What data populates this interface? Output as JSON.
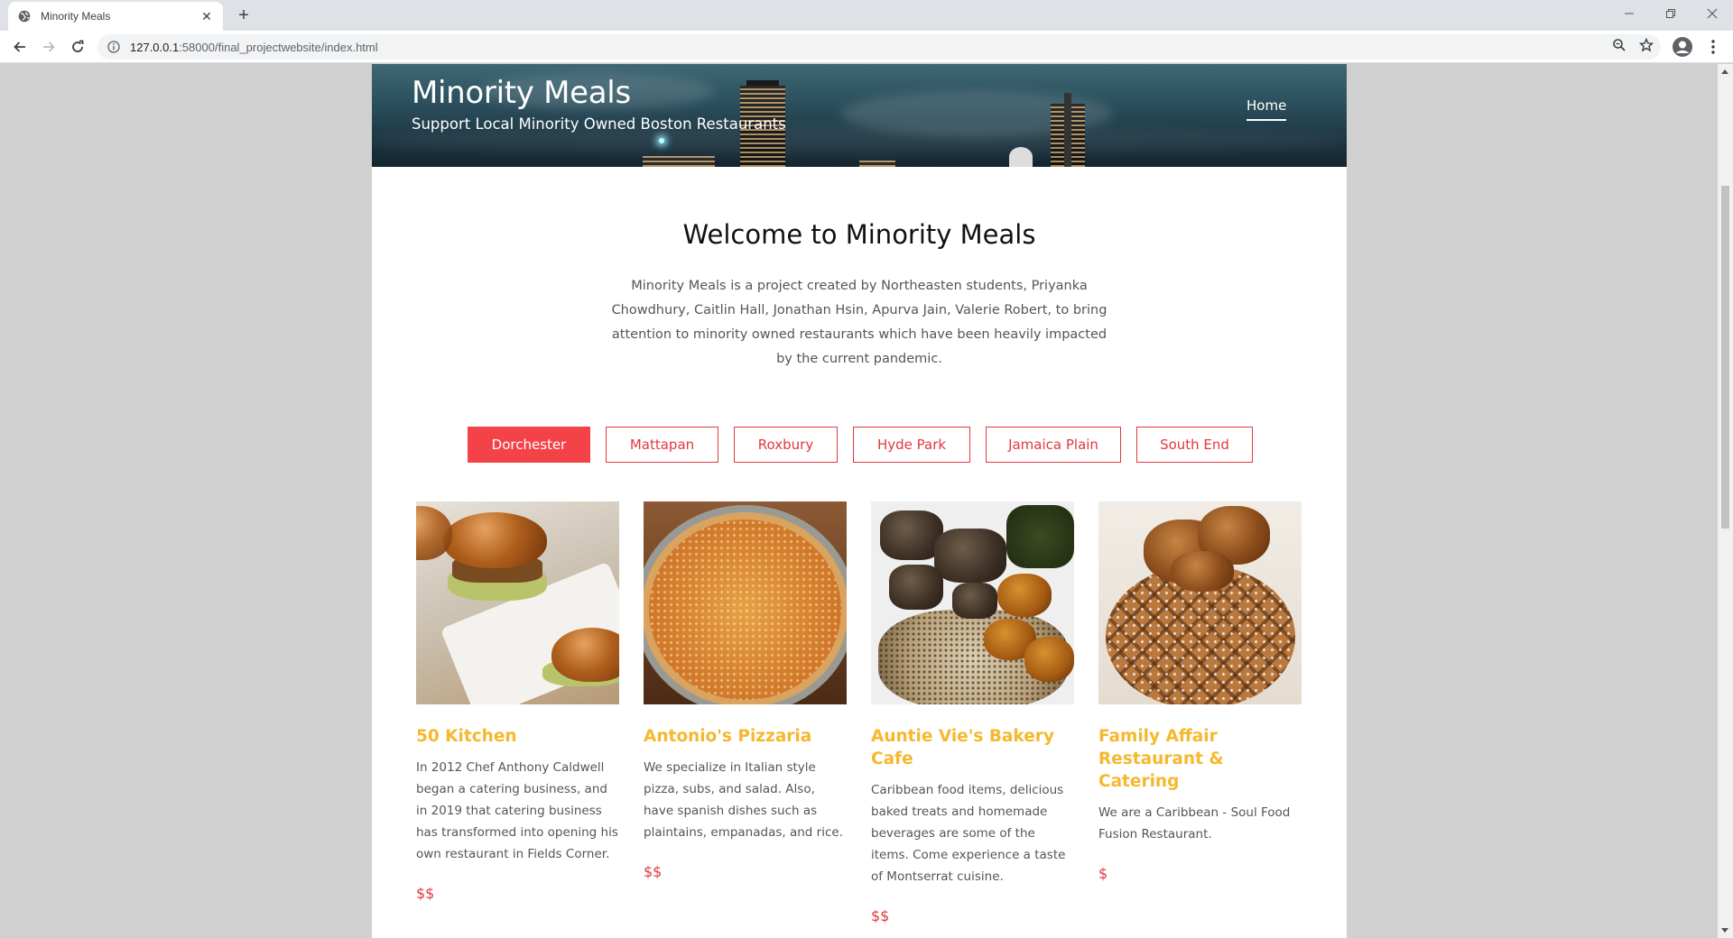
{
  "browser": {
    "tab_title": "Minority Meals",
    "url_host": "127.0.0.1",
    "url_rest": ":58000/final_projectwebsite/index.html",
    "tab_close_glyph": "✕",
    "new_tab_glyph": "+"
  },
  "site": {
    "title": "Minority Meals",
    "subtitle": "Support Local Minority Owned Boston Restaurants",
    "nav": {
      "home": "Home"
    }
  },
  "welcome": {
    "heading": "Welcome to Minority Meals",
    "intro": "Minority Meals is a project created by Northeasten students, Priyanka Chowdhury, Caitlin Hall, Jonathan Hsin, Apurva Jain, Valerie Robert, to bring attention to minority owned restaurants which have been heavily impacted by the current pandemic."
  },
  "filters": {
    "active": "Dorchester",
    "items": [
      "Dorchester",
      "Mattapan",
      "Roxbury",
      "Hyde Park",
      "Jamaica Plain",
      "South End"
    ]
  },
  "restaurants": [
    {
      "name": "50 Kitchen",
      "description": "In 2012 Chef Anthony Caldwell began a catering business, and in 2019 that catering business has transformed into opening his own restaurant in Fields Corner.",
      "price": "$$",
      "image_icon": "sliders-photo"
    },
    {
      "name": "Antonio's Pizzaria",
      "description": "We specialize in Italian style pizza, subs, and salad. Also, have spanish dishes such as plaintains, empanadas, and rice.",
      "price": "$$",
      "image_icon": "pizza-photo"
    },
    {
      "name": "Auntie Vie's Bakery Cafe",
      "description": "Caribbean food items, delicious baked treats and homemade beverages are some of the items. Come experience a taste of Montserrat cuisine.",
      "price": "$$",
      "image_icon": "caribbean-plate-photo"
    },
    {
      "name": "Family Affair Restaurant & Catering",
      "description": "We are a Caribbean - Soul Food Fusion Restaurant.",
      "price": "$",
      "image_icon": "chicken-waffle-photo"
    }
  ],
  "colors": {
    "accent_red": "#f44348",
    "restaurant_name": "#f5b82e",
    "price_red": "#e0393e"
  }
}
